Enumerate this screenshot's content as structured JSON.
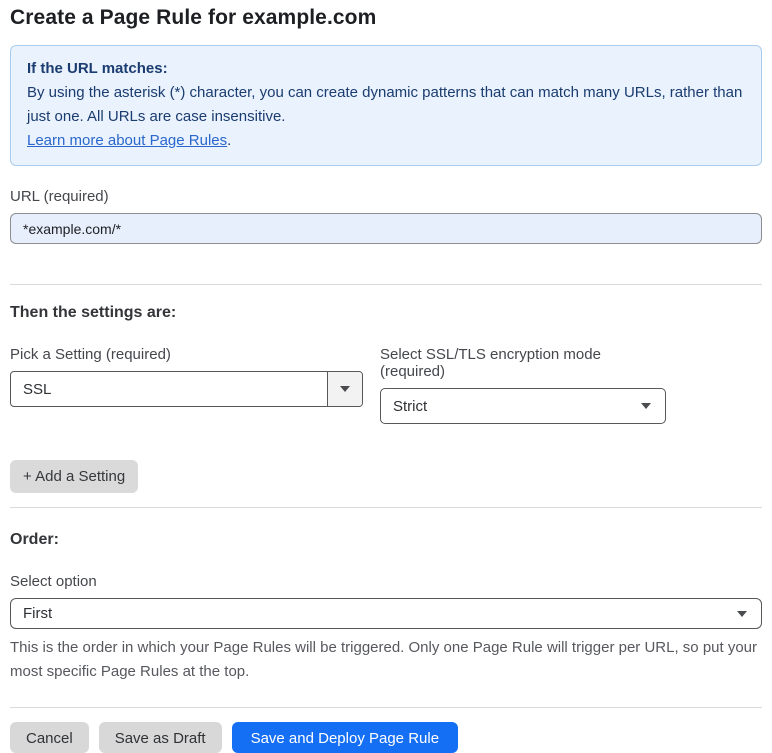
{
  "page": {
    "title": "Create a Page Rule for example.com"
  },
  "info_box": {
    "heading": "If the URL matches:",
    "body": "By using the asterisk (*) character, you can create dynamic patterns that can match many URLs, rather than just one. All URLs are case insensitive.",
    "link_label": "Learn more about Page Rules",
    "link_suffix": "."
  },
  "url_field": {
    "label": "URL (required)",
    "value": "*example.com/*"
  },
  "settings_section": {
    "heading": "Then the settings are:",
    "setting_picker": {
      "label": "Pick a Setting (required)",
      "value": "SSL"
    },
    "ssl_mode": {
      "label": "Select SSL/TLS encryption mode (required)",
      "value": "Strict"
    },
    "add_setting_label": "+ Add a Setting"
  },
  "order_section": {
    "heading": "Order:",
    "select_label": "Select option",
    "value": "First",
    "help_text": "This is the order in which your Page Rules will be triggered. Only one Page Rule will trigger per URL, so put your most specific Page Rules at the top."
  },
  "footer": {
    "cancel_label": "Cancel",
    "save_draft_label": "Save as Draft",
    "save_deploy_label": "Save and Deploy Page Rule"
  },
  "icons": {
    "dropdown": "caret-down-icon"
  },
  "colors": {
    "info_bg": "#e9f2fd",
    "info_border": "#aacdee",
    "info_text": "#1b3c70",
    "link_blue": "#2a67cc",
    "input_bg": "#e7effc",
    "primary_button_blue": "#156ff5",
    "gray_button": "#d8d8d8",
    "select_border": "#58585a"
  }
}
